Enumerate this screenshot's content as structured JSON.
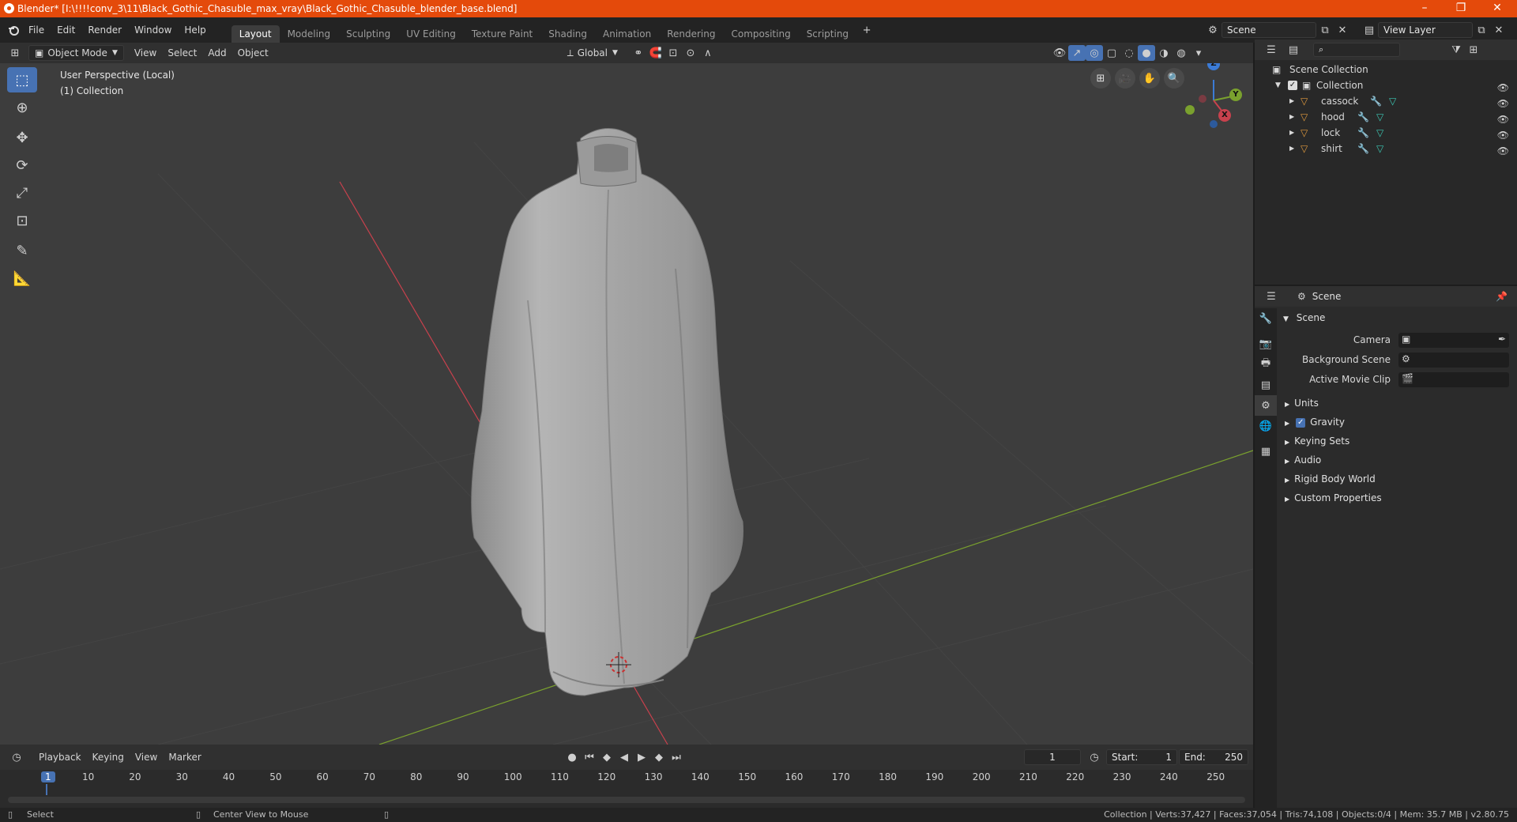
{
  "window": {
    "title": "Blender* [I:\\!!!!conv_3\\11\\Black_Gothic_Chasuble_max_vray\\Black_Gothic_Chasuble_blender_base.blend]",
    "min": "–",
    "restore": "❐",
    "close": "✕"
  },
  "menu": [
    "File",
    "Edit",
    "Render",
    "Window",
    "Help"
  ],
  "workspaces": [
    "Layout",
    "Modeling",
    "Sculpting",
    "UV Editing",
    "Texture Paint",
    "Shading",
    "Animation",
    "Rendering",
    "Compositing",
    "Scripting"
  ],
  "workspace_add": "+",
  "scene_selector": {
    "value": "Scene"
  },
  "view_layer_selector": {
    "value": "View Layer"
  },
  "viewport_header": {
    "mode": "Object Mode",
    "menus": [
      "View",
      "Select",
      "Add",
      "Object"
    ],
    "orientation": "Global"
  },
  "viewport_info": {
    "line1": "User Perspective (Local)",
    "line2": "(1) Collection"
  },
  "gizmo": {
    "z": "Z",
    "y": "Y",
    "x": "X"
  },
  "outliner": {
    "search_placeholder": "",
    "root": "Scene Collection",
    "collection": "Collection",
    "items": [
      {
        "name": "cassock"
      },
      {
        "name": "hood"
      },
      {
        "name": "lock"
      },
      {
        "name": "shirt"
      }
    ]
  },
  "properties": {
    "header": "Scene",
    "panel": "Scene",
    "camera_label": "Camera",
    "bg_scene_label": "Background Scene",
    "movie_clip_label": "Active Movie Clip",
    "subpanels": [
      "Units",
      "Gravity",
      "Keying Sets",
      "Audio",
      "Rigid Body World",
      "Custom Properties"
    ]
  },
  "timeline": {
    "menus": [
      "Playback",
      "Keying",
      "View",
      "Marker"
    ],
    "current_frame": "1",
    "start_label": "Start:",
    "start": "1",
    "end_label": "End:",
    "end": "250",
    "ruler": [
      "1",
      "10",
      "20",
      "30",
      "40",
      "50",
      "60",
      "70",
      "80",
      "90",
      "100",
      "110",
      "120",
      "130",
      "140",
      "150",
      "160",
      "170",
      "180",
      "190",
      "200",
      "210",
      "220",
      "230",
      "240",
      "250"
    ]
  },
  "statusbar": {
    "left": "Select",
    "middle": "Center View to Mouse",
    "right": "Collection | Verts:37,427 | Faces:37,054 | Tris:74,108 | Objects:0/4 | Mem: 35.7 MB | v2.80.75"
  },
  "colors": {
    "titlebar": "#e44a0b",
    "accent": "#4772b3",
    "x_axis": "#c8414d",
    "y_axis": "#7aa12e",
    "z_axis": "#3b7bd6"
  }
}
